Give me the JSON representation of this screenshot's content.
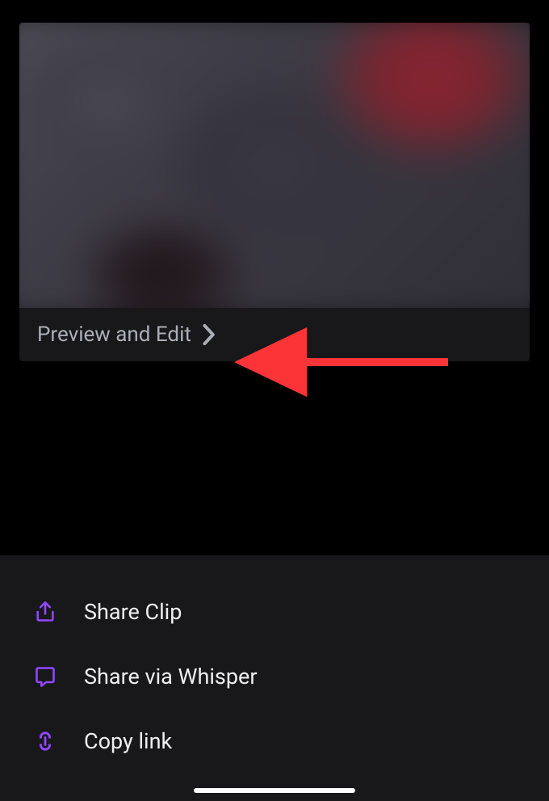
{
  "preview": {
    "edit_label": "Preview and Edit"
  },
  "share": {
    "items": [
      {
        "label": "Share Clip",
        "icon": "share-icon"
      },
      {
        "label": "Share via Whisper",
        "icon": "whisper-icon"
      },
      {
        "label": "Copy link",
        "icon": "link-icon"
      }
    ]
  },
  "colors": {
    "accent": "#9147ff",
    "background_dark": "#000000",
    "background_sheet": "#18181b",
    "text_primary": "#efeff1",
    "text_secondary": "#adadb8",
    "annotation_arrow": "#fc3438"
  }
}
